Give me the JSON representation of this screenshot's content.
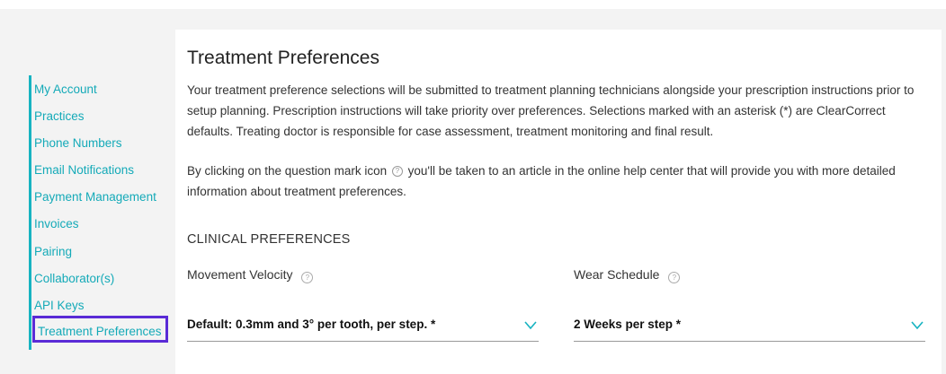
{
  "sidebar": {
    "items": [
      {
        "label": "My Account"
      },
      {
        "label": "Practices"
      },
      {
        "label": "Phone Numbers"
      },
      {
        "label": "Email Notifications"
      },
      {
        "label": "Payment Management"
      },
      {
        "label": "Invoices"
      },
      {
        "label": "Pairing"
      },
      {
        "label": "Collaborator(s)"
      },
      {
        "label": "API Keys"
      },
      {
        "label": "Treatment Preferences"
      }
    ],
    "accent_color": "#17b3c1",
    "active_outline_color": "#5a2bd6"
  },
  "main": {
    "title": "Treatment Preferences",
    "intro": "Your treatment preference selections will be submitted to treatment planning technicians alongside your prescription instructions prior to setup planning. Prescription instructions will take priority over preferences. Selections marked with an asterisk (*) are ClearCorrect defaults. Treating doctor is responsible for case assessment, treatment monitoring and final result.",
    "help_text_before": "By clicking on the question mark icon",
    "help_text_after": "you'll be taken to an article in the online help center that will provide you with more detailed information about treatment preferences.",
    "section_title": "CLINICAL PREFERENCES",
    "fields": {
      "movement_velocity": {
        "label": "Movement Velocity",
        "value": "Default: 0.3mm and 3° per tooth, per step. *"
      },
      "wear_schedule": {
        "label": "Wear Schedule",
        "value": "2 Weeks per step *"
      }
    },
    "icons": {
      "help": "question-mark-circle-icon",
      "dropdown": "chevron-down-icon"
    }
  }
}
